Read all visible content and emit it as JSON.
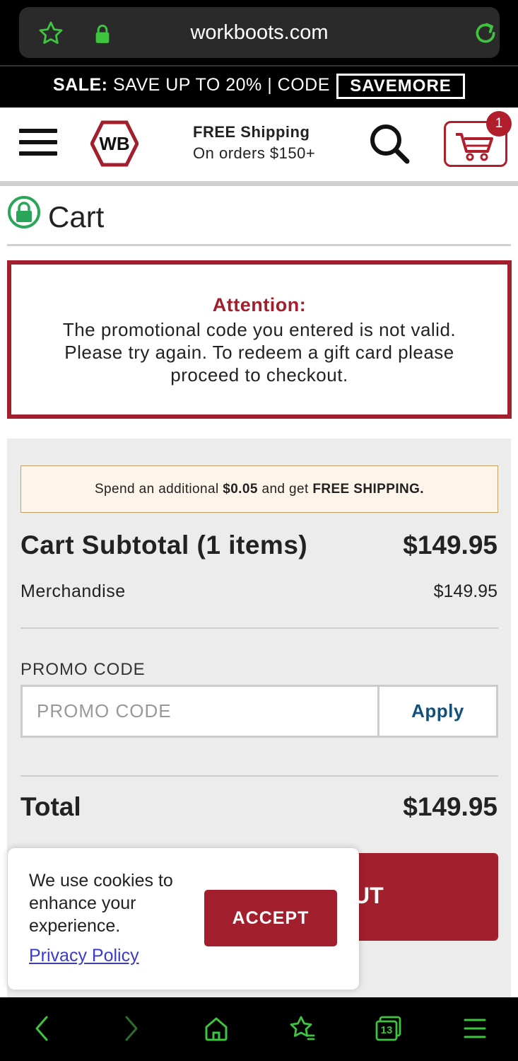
{
  "browser": {
    "url": "workboots.com",
    "tab_count": "13"
  },
  "promo_banner": {
    "sale_label": "SALE:",
    "sale_text": " SAVE UP TO 20% | CODE",
    "code": "SAVEMORE"
  },
  "header": {
    "logo_text": "WB",
    "shipping_title": "FREE Shipping",
    "shipping_sub": "On orders $150+",
    "cart_count": "1"
  },
  "page": {
    "title": "Cart"
  },
  "alert": {
    "title": "Attention:",
    "message": "The promotional code you entered is not valid. Please try again. To redeem a gift card please proceed to checkout."
  },
  "summary": {
    "free_ship_pre": "Spend an additional ",
    "free_ship_amount": "$0.05",
    "free_ship_mid": " and get ",
    "free_ship_bold": "FREE SHIPPING.",
    "subtotal_label": "Cart Subtotal (1 items)",
    "subtotal_value": "$149.95",
    "merch_label": "Merchandise",
    "merch_value": "$149.95",
    "promo_label": "PROMO CODE",
    "promo_placeholder": "PROMO CODE",
    "apply_label": "Apply",
    "total_label": "Total",
    "total_value": "$149.95",
    "checkout_visible_text": "UT"
  },
  "cookie": {
    "message": "We use cookies to enhance your experience.",
    "link": "Privacy Policy",
    "accept": "ACCEPT"
  },
  "colors": {
    "brand_red": "#a21f2d",
    "browser_accent": "#3ec43e",
    "link_blue": "#12507d"
  },
  "icons": {
    "star": "star-icon",
    "lock": "lock-icon",
    "reload": "reload-icon",
    "menu": "hamburger-icon",
    "search": "search-icon",
    "cart": "cart-icon",
    "back": "back-icon",
    "forward": "forward-icon",
    "home": "home-icon",
    "bookmarks": "bookmarks-icon",
    "tabs": "tabs-icon",
    "menu_bottom": "menu-icon"
  }
}
